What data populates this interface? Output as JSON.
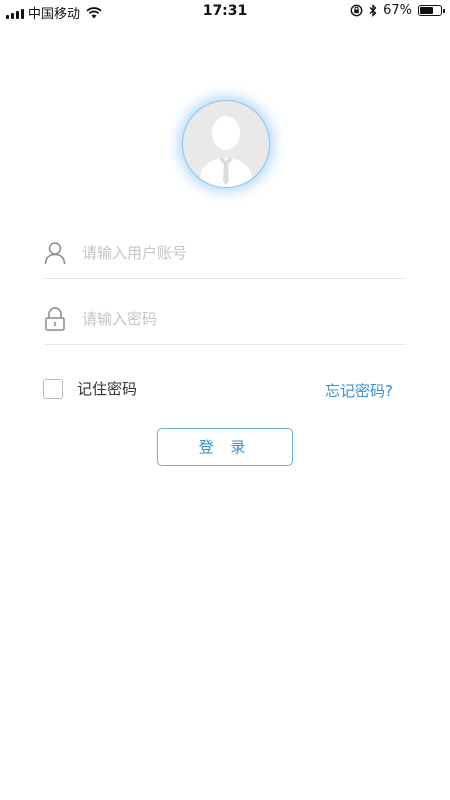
{
  "status_bar": {
    "carrier": "中国移动",
    "time": "17:31",
    "battery_percent": "67%",
    "battery_level": 0.67
  },
  "login": {
    "avatar_icon": "default-user-avatar",
    "username_placeholder": "请输入用户账号",
    "password_placeholder": "请输入密码",
    "remember_label": "记住密码",
    "remember_checked": false,
    "forgot_label": "忘记密码?",
    "submit_label": "登 录"
  },
  "colors": {
    "accent": "#3a8ed0",
    "button_border": "#6aaee2",
    "placeholder": "#c4c4c4"
  }
}
